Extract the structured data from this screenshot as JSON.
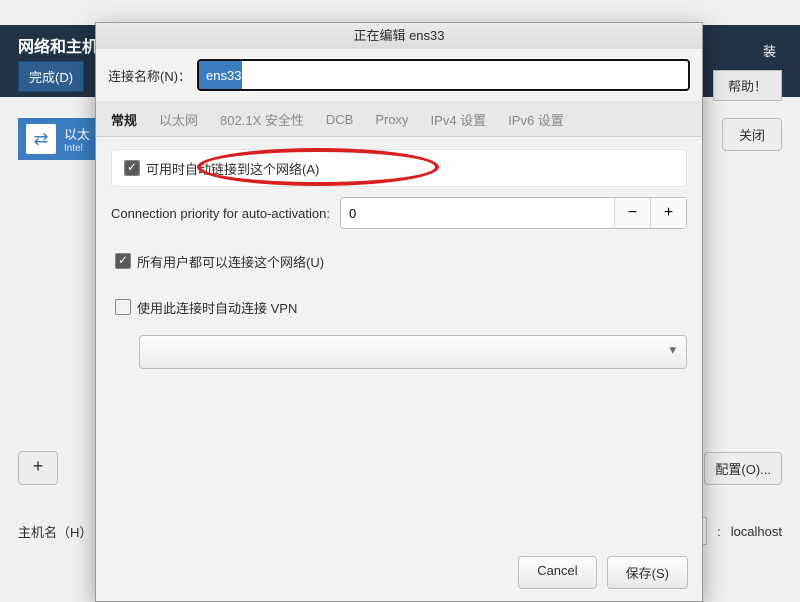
{
  "bg": {
    "title": "网络和主机",
    "done": "完成(D)",
    "install_btn": "装",
    "help": "帮助！",
    "device_name": "以太",
    "device_sub": "Intel",
    "close": "关闭",
    "add": "+",
    "configure": "配置(O)...",
    "host_label": "主机名（H）",
    "host_val": "",
    "localhost": "localhost"
  },
  "dialog": {
    "title": "正在编辑 ens33",
    "name_label": "连接名称(N)：",
    "name_val": "ens33",
    "tabs": [
      "常规",
      "以太网",
      "802.1X 安全性",
      "DCB",
      "Proxy",
      "IPv4 设置",
      "IPv6 设置"
    ],
    "auto_connect": "可用时自动链接到这个网络(A)",
    "priority_label": "Connection priority for auto-activation:",
    "priority_val": "0",
    "all_users": "所有用户都可以连接这个网络(U)",
    "auto_vpn": "使用此连接时自动连接 VPN",
    "cancel": "Cancel",
    "save": "保存(S)"
  }
}
